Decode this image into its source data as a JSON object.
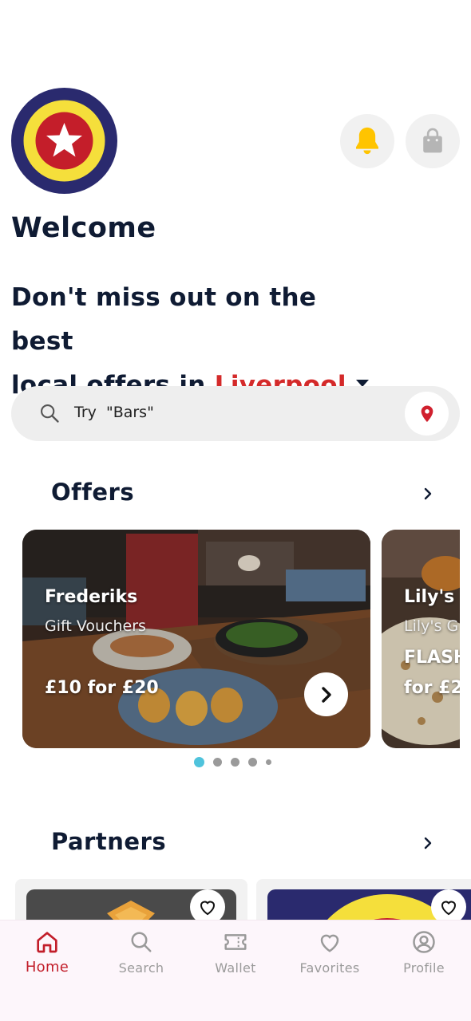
{
  "header": {
    "logo_icon": "star-roundel-logo",
    "notification_icon": "bell-icon",
    "bag_icon": "shopping-bag-icon",
    "colors": {
      "bell": "#ffc400",
      "logo_navy": "#2a2a6e",
      "logo_yellow": "#f5df3b",
      "logo_red": "#c41e2a"
    }
  },
  "welcome": "Welcome",
  "tagline": {
    "line1": "Don't miss out on the best",
    "prefix": "local offers in ",
    "city": "Liverpool"
  },
  "search": {
    "placeholder": "Try  \"Bars\"",
    "search_icon": "search-icon",
    "location_icon": "map-pin-icon"
  },
  "offers": {
    "title": "Offers",
    "cards": [
      {
        "name": "Frederiks",
        "subtitle": "Gift Vouchers",
        "deal": "£10 for £20"
      },
      {
        "name": "Lily's",
        "subtitle": "Lily's G",
        "flash": "FLASH",
        "deal": "for £2"
      }
    ],
    "pagination": {
      "count": 5,
      "active": 0,
      "accent": "#4fc3dc"
    }
  },
  "partners": {
    "title": "Partners"
  },
  "tabbar": {
    "active_color": "#c21e2a",
    "tabs": [
      {
        "label": "Home",
        "icon": "home-icon"
      },
      {
        "label": "Search",
        "icon": "search-icon"
      },
      {
        "label": "Wallet",
        "icon": "ticket-icon"
      },
      {
        "label": "Favorites",
        "icon": "heart-icon"
      },
      {
        "label": "Profile",
        "icon": "user-icon"
      }
    ]
  }
}
